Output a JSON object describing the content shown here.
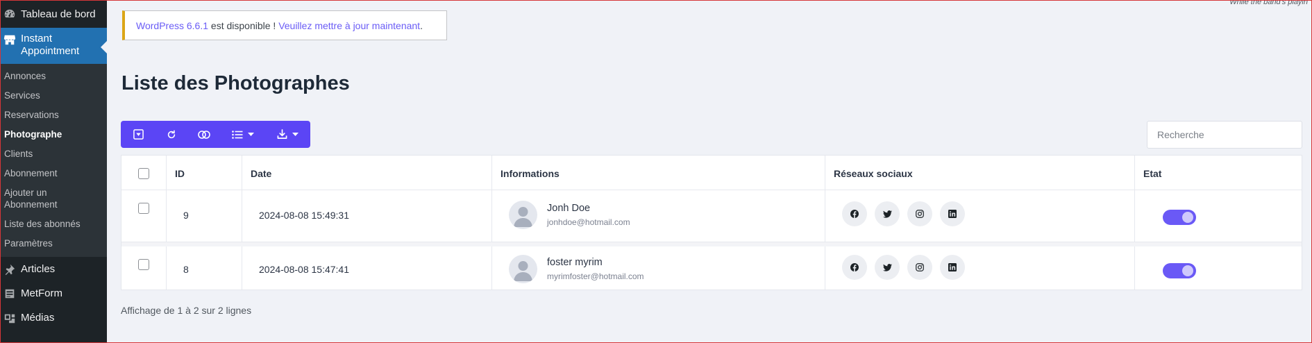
{
  "top_right_text": "While the band's playin",
  "sidebar": {
    "dashboard": {
      "label": "Tableau de bord",
      "icon": "dashboard-icon"
    },
    "active": {
      "label_line1": "Instant",
      "label_line2": "Appointment",
      "icon": "store-icon"
    },
    "submenu": [
      {
        "label": "Annonces"
      },
      {
        "label": "Services"
      },
      {
        "label": "Reservations"
      },
      {
        "label": "Photographe",
        "current": true
      },
      {
        "label": "Clients"
      },
      {
        "label": "Abonnement"
      },
      {
        "label": "Ajouter un Abonnement"
      },
      {
        "label": "Liste des abonnés"
      },
      {
        "label": "Paramètres"
      }
    ],
    "items": [
      {
        "label": "Articles",
        "icon": "pin-icon"
      },
      {
        "label": "MetForm",
        "icon": "form-icon"
      },
      {
        "label": "Médias",
        "icon": "media-icon"
      }
    ]
  },
  "notice": {
    "version_link": "WordPress 6.6.1",
    "text": " est disponible ! ",
    "update_link": "Veuillez mettre à jour maintenant",
    "end": "."
  },
  "page_title": "Liste des Photographes",
  "toolbar": {
    "buttons": [
      "toggle-filter-icon",
      "refresh-icon",
      "toggle-view-icon",
      "columns-list-icon",
      "download-icon"
    ],
    "color": "#5b45f5"
  },
  "search": {
    "placeholder": "Recherche",
    "value": ""
  },
  "table": {
    "headers": {
      "id": "ID",
      "date": "Date",
      "info": "Informations",
      "social": "Réseaux sociaux",
      "state": "Etat"
    },
    "rows": [
      {
        "id": "9",
        "date": "2024-08-08 15:49:31",
        "name": "Jonh Doe",
        "email": "jonhdoe@hotmail.com",
        "state": "on"
      },
      {
        "id": "8",
        "date": "2024-08-08 15:47:41",
        "name": "foster myrim",
        "email": "myrimfoster@hotmail.com",
        "state": "on"
      }
    ],
    "social_icons": [
      "facebook-icon",
      "twitter-icon",
      "instagram-icon",
      "linkedin-icon"
    ]
  },
  "footer": "Affichage de 1 à 2 sur 2 lignes"
}
